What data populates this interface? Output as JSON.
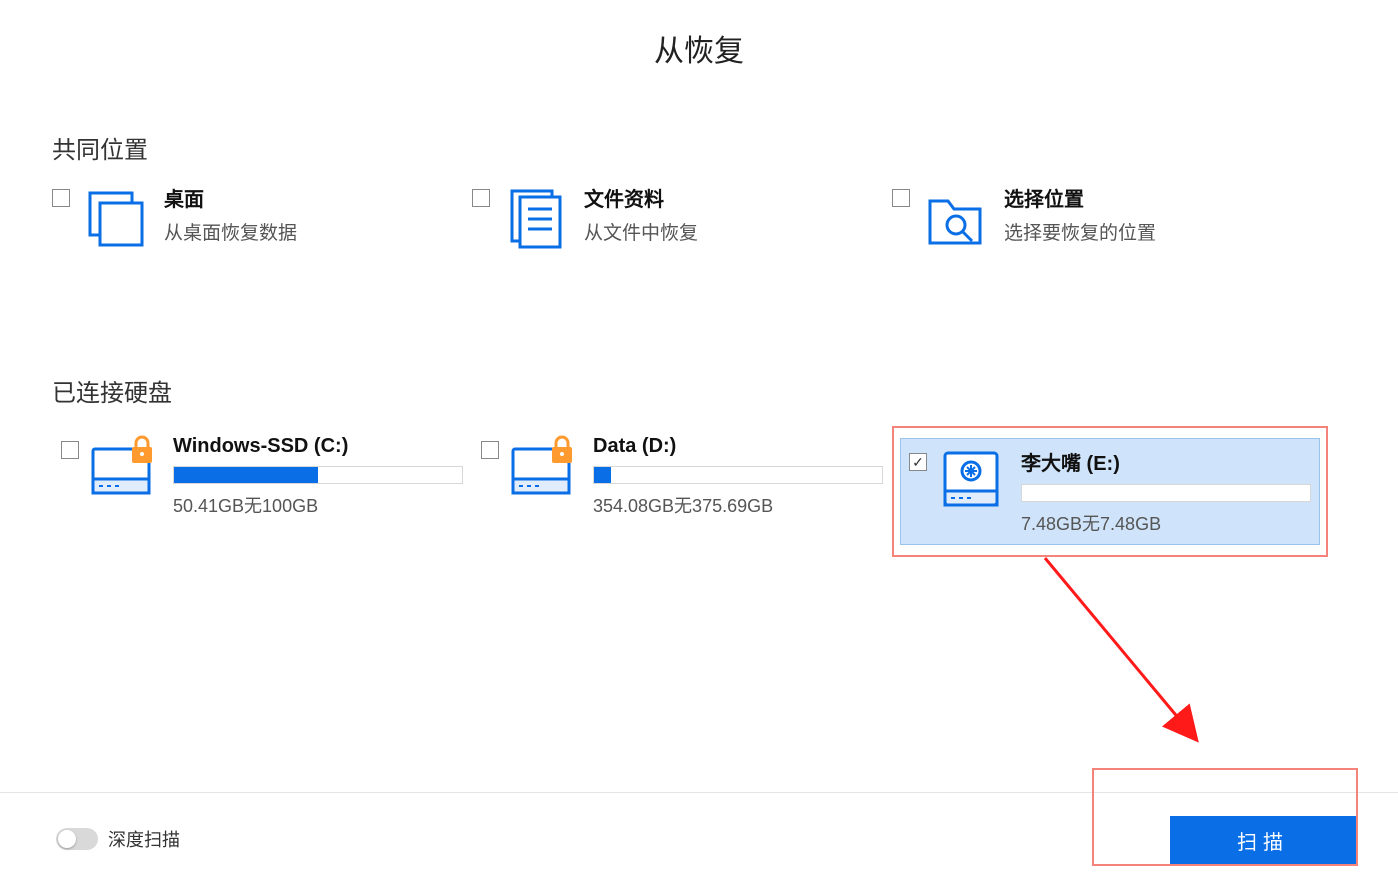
{
  "title": "从恢复",
  "common_section": {
    "heading": "共同位置",
    "items": [
      {
        "title": "桌面",
        "subtitle": "从桌面恢复数据",
        "checked": false
      },
      {
        "title": "文件资料",
        "subtitle": "从文件中恢复",
        "checked": false
      },
      {
        "title": "选择位置",
        "subtitle": "选择要恢复的位置",
        "checked": false
      }
    ]
  },
  "disks_section": {
    "heading": "已连接硬盘",
    "disks": [
      {
        "name": "Windows-SSD (C:)",
        "size_text": "50.41GB无100GB",
        "used_pct": 50,
        "locked": true,
        "checked": false,
        "selected": false,
        "usb": false
      },
      {
        "name": "Data (D:)",
        "size_text": "354.08GB无375.69GB",
        "used_pct": 6,
        "locked": true,
        "checked": false,
        "selected": false,
        "usb": false
      },
      {
        "name": "李大嘴 (E:)",
        "size_text": "7.48GB无7.48GB",
        "used_pct": 0,
        "locked": false,
        "checked": true,
        "selected": true,
        "usb": true
      }
    ]
  },
  "deep_scan_label": "深度扫描",
  "scan_button": "扫描"
}
